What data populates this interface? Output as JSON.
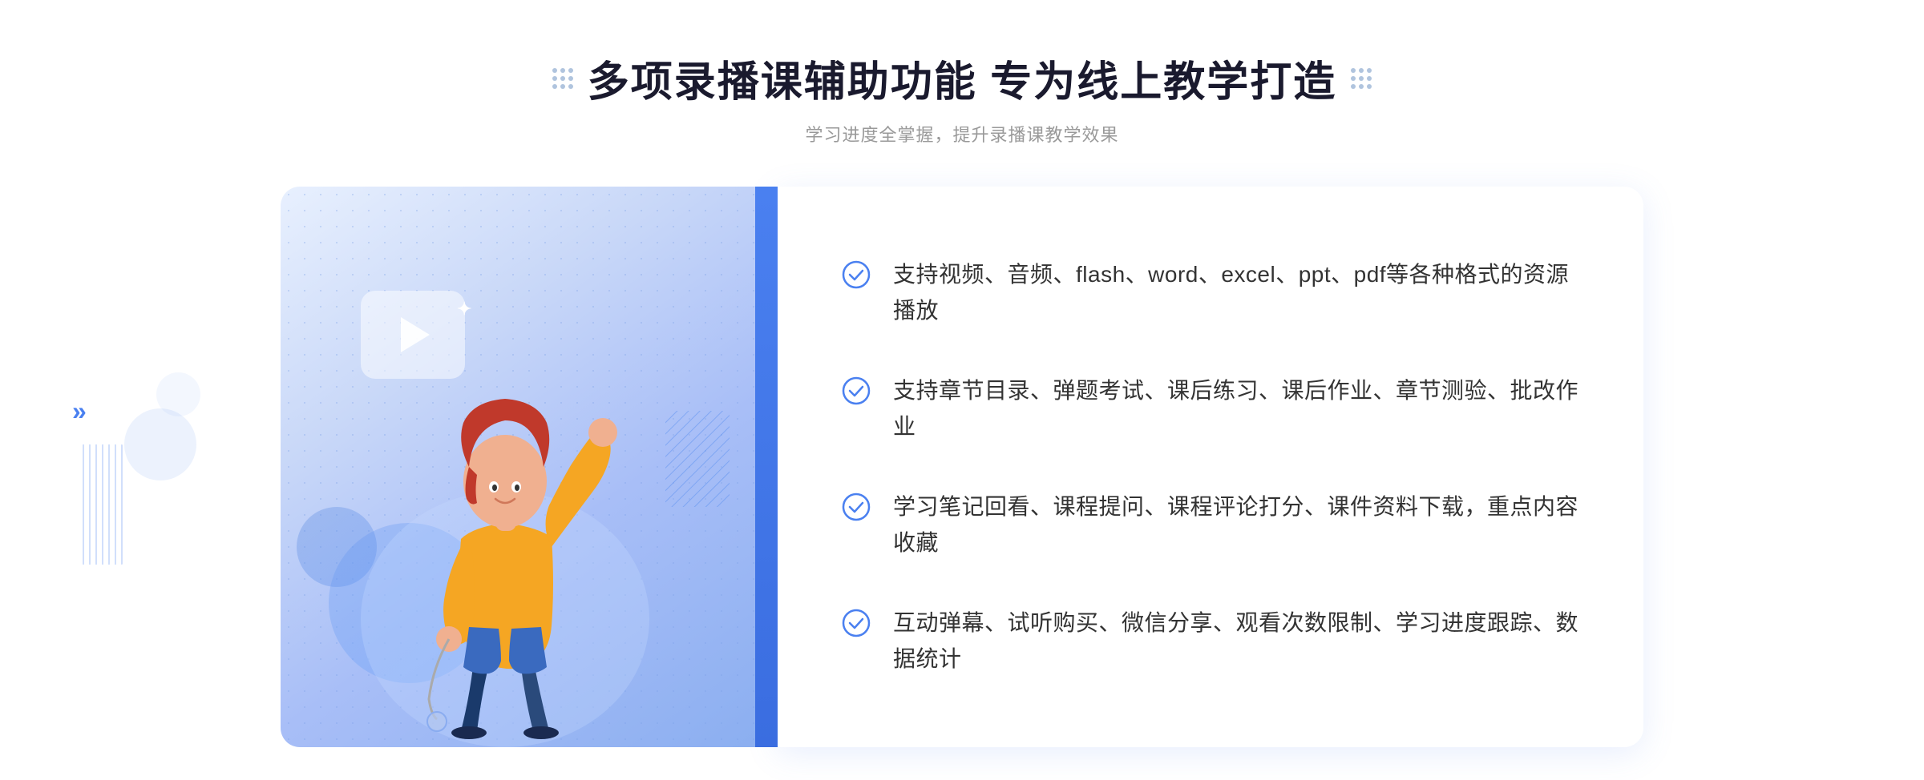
{
  "header": {
    "title": "多项录播课辅助功能 专为线上教学打造",
    "subtitle": "学习进度全掌握，提升录播课教学效果"
  },
  "features": [
    {
      "id": 1,
      "text": "支持视频、音频、flash、word、excel、ppt、pdf等各种格式的资源播放"
    },
    {
      "id": 2,
      "text": "支持章节目录、弹题考试、课后练习、课后作业、章节测验、批改作业"
    },
    {
      "id": 3,
      "text": "学习笔记回看、课程提问、课程评论打分、课件资料下载，重点内容收藏"
    },
    {
      "id": 4,
      "text": "互动弹幕、试听购买、微信分享、观看次数限制、学习进度跟踪、数据统计"
    }
  ],
  "icons": {
    "check_color": "#4a80f0",
    "dot_color": "#b0c4de"
  }
}
